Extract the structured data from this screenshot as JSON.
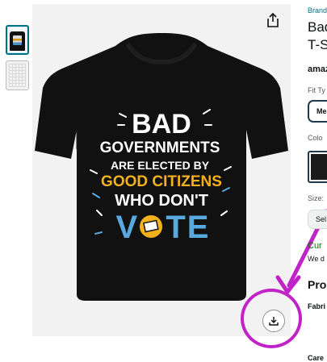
{
  "thumbnails": [
    {
      "alt": "shirt thumbnail",
      "selected": true
    },
    {
      "alt": "size chart thumbnail",
      "selected": false
    }
  ],
  "shirt_design": {
    "line1": "BAD",
    "line2": "GOVERNMENTS",
    "line3": "ARE ELECTED BY",
    "line4": "GOOD CITIZENS",
    "line5": "WHO DON'T",
    "line6": "VOTE",
    "colors": {
      "white": "#ffffff",
      "yellow": "#f3b21b",
      "blue": "#58a9e0",
      "shirt": "#111111"
    }
  },
  "product": {
    "brand": "Brand",
    "title_line1": "Bad",
    "title_line2": "T-S",
    "amazon_logo": "amaz",
    "fit_label": "Fit Ty",
    "fit_button": "Me",
    "color_label": "Colo",
    "size_label": "Size:",
    "size_select": "Sel",
    "availability": "Cur",
    "delivery": "We d",
    "section_heading": "Pro",
    "fabric_label": "Fabri",
    "care_label": "Care"
  },
  "icons": {
    "share": "share-icon",
    "download": "download-icon"
  },
  "annotation_color": "#c123c8"
}
